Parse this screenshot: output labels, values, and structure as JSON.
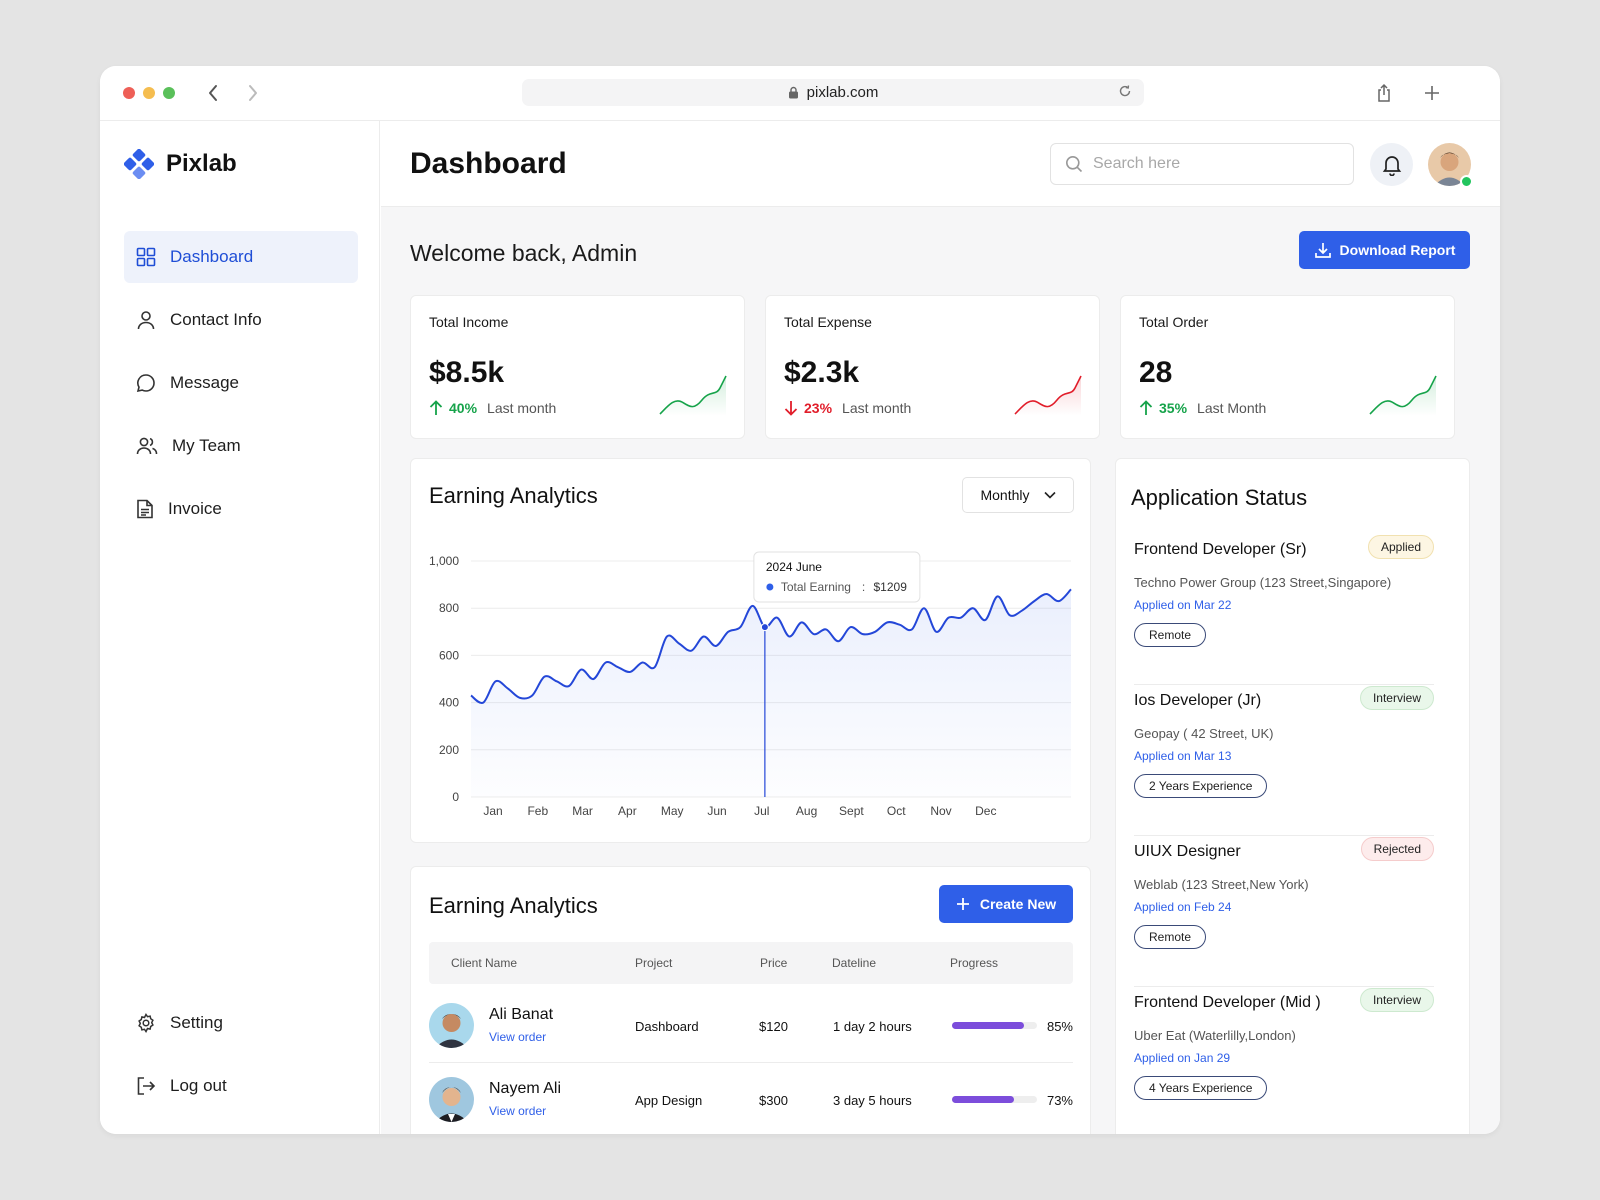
{
  "browser": {
    "url": "pixlab.com"
  },
  "brand": {
    "name": "Pixlab",
    "accent": "#2f5fe8"
  },
  "sidebar": {
    "items": [
      {
        "label": "Dashboard",
        "icon": "grid-icon",
        "active": true
      },
      {
        "label": "Contact Info",
        "icon": "user-icon"
      },
      {
        "label": "Message",
        "icon": "chat-icon"
      },
      {
        "label": "My Team",
        "icon": "team-icon"
      },
      {
        "label": "Invoice",
        "icon": "document-icon"
      }
    ],
    "bottom": [
      {
        "label": "Setting",
        "icon": "gear-icon"
      },
      {
        "label": "Log out",
        "icon": "logout-icon"
      }
    ]
  },
  "header": {
    "title": "Dashboard",
    "search_placeholder": "Search here"
  },
  "welcome": {
    "text": "Welcome back, Admin",
    "download_label": "Download Report"
  },
  "stats": [
    {
      "label": "Total Income",
      "value": "$8.5k",
      "change": "40%",
      "direction": "up",
      "period": "Last month",
      "color": "#16a34a"
    },
    {
      "label": "Total Expense",
      "value": "$2.3k",
      "change": "23%",
      "direction": "down",
      "period": "Last month",
      "color": "#e11d2a"
    },
    {
      "label": "Total Order",
      "value": "28",
      "change": "35%",
      "direction": "up",
      "period": "Last Month",
      "color": "#16a34a"
    }
  ],
  "earning_chart": {
    "title": "Earning Analytics",
    "filter": "Monthly",
    "tooltip": {
      "title": "2024 June",
      "label": "Total Earning",
      "value": "$1209"
    }
  },
  "chart_data": {
    "type": "line",
    "x": [
      "Jan",
      "Feb",
      "Mar",
      "Apr",
      "May",
      "Jun",
      "Jul",
      "Aug",
      "Sept",
      "Oct",
      "Nov",
      "Dec"
    ],
    "series": [
      {
        "name": "Total Earning",
        "values": [
          430,
          400,
          490,
          460,
          420,
          430,
          510,
          490,
          470,
          540,
          500,
          570,
          550,
          530,
          570,
          550,
          680,
          650,
          620,
          680,
          640,
          700,
          720,
          810,
          720,
          760,
          680,
          740,
          690,
          710,
          660,
          720,
          690,
          700,
          740,
          730,
          710,
          800,
          700,
          760,
          760,
          800,
          750,
          850,
          770,
          790,
          830,
          860,
          830,
          880
        ]
      }
    ],
    "ylim": [
      0,
      1000
    ],
    "yticks": [
      0,
      200,
      400,
      600,
      800,
      1000
    ],
    "grid": true,
    "highlight_index": 24
  },
  "orders": {
    "title": "Earning Analytics",
    "create_label": "Create New",
    "columns": [
      "Client Name",
      "Project",
      "Price",
      "Dateline",
      "Progress"
    ],
    "rows": [
      {
        "name": "Ali Banat",
        "link": "View order",
        "project": "Dashboard",
        "price": "$120",
        "dateline": "1 day 2 hours",
        "progress": 85,
        "progress_label": "85%"
      },
      {
        "name": "Nayem Ali",
        "link": "View order",
        "project": "App Design",
        "price": "$300",
        "dateline": "3 day 5 hours",
        "progress": 73,
        "progress_label": "73%"
      }
    ]
  },
  "applications": {
    "title": "Application Status",
    "items": [
      {
        "title": "Frontend Developer (Sr)",
        "status": "Applied",
        "status_bg": "#fdf6e3",
        "status_border": "#f1e1b0",
        "company": "Techno Power Group (123 Street,Singapore)",
        "date": "Applied on Mar 22",
        "tag": "Remote"
      },
      {
        "title": "Ios Developer (Jr)",
        "status": "Interview",
        "status_bg": "#e9f7ea",
        "status_border": "#cde9cf",
        "company": "Geopay ( 42 Street, UK)",
        "date": "Applied on Mar 13",
        "tag": "2 Years Experience"
      },
      {
        "title": "UIUX Designer",
        "status": "Rejected",
        "status_bg": "#fdecec",
        "status_border": "#f5cccc",
        "company": "Weblab (123 Street,New York)",
        "date": "Applied on Feb 24",
        "tag": "Remote"
      },
      {
        "title": "Frontend Developer (Mid )",
        "status": "Interview",
        "status_bg": "#e9f7ea",
        "status_border": "#cde9cf",
        "company": "Uber Eat (Waterlilly,London)",
        "date": "Applied on Jan 29",
        "tag": "4 Years Experience"
      }
    ]
  }
}
